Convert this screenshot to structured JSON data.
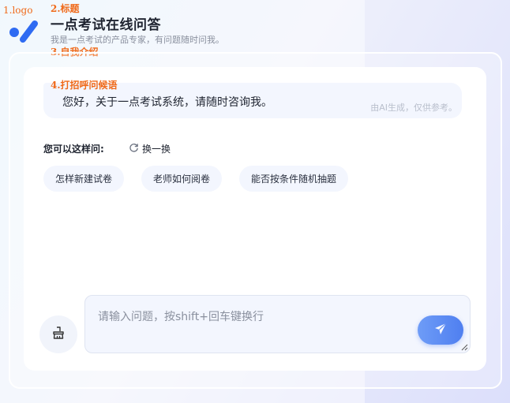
{
  "annotations": {
    "logo": "1.logo",
    "title": "2.标题",
    "intro": "3.自我介绍",
    "greeting": "4.打招呼问候语"
  },
  "header": {
    "title": "一点考试在线问答",
    "subtitle": "我是一点考试的产品专家，有问题随时问我。"
  },
  "greeting": {
    "text": "您好，关于一点考试系统，请随时咨询我。",
    "ai_note": "由AI生成，仅供参考。"
  },
  "suggestions": {
    "label": "您可以这样问:",
    "refresh_label": "换一换",
    "items": [
      "怎样新建试卷",
      "老师如何阅卷",
      "能否按条件随机抽题"
    ]
  },
  "input": {
    "placeholder": "请输入问题，按shift+回车键换行",
    "value": ""
  },
  "icons": {
    "logo": "logo-icon",
    "refresh": "refresh-icon",
    "clear": "broom-icon",
    "send": "send-icon"
  },
  "colors": {
    "accent": "#4f7ff0",
    "annotation": "#f06a1a",
    "bubble": "#f3f6fe"
  }
}
